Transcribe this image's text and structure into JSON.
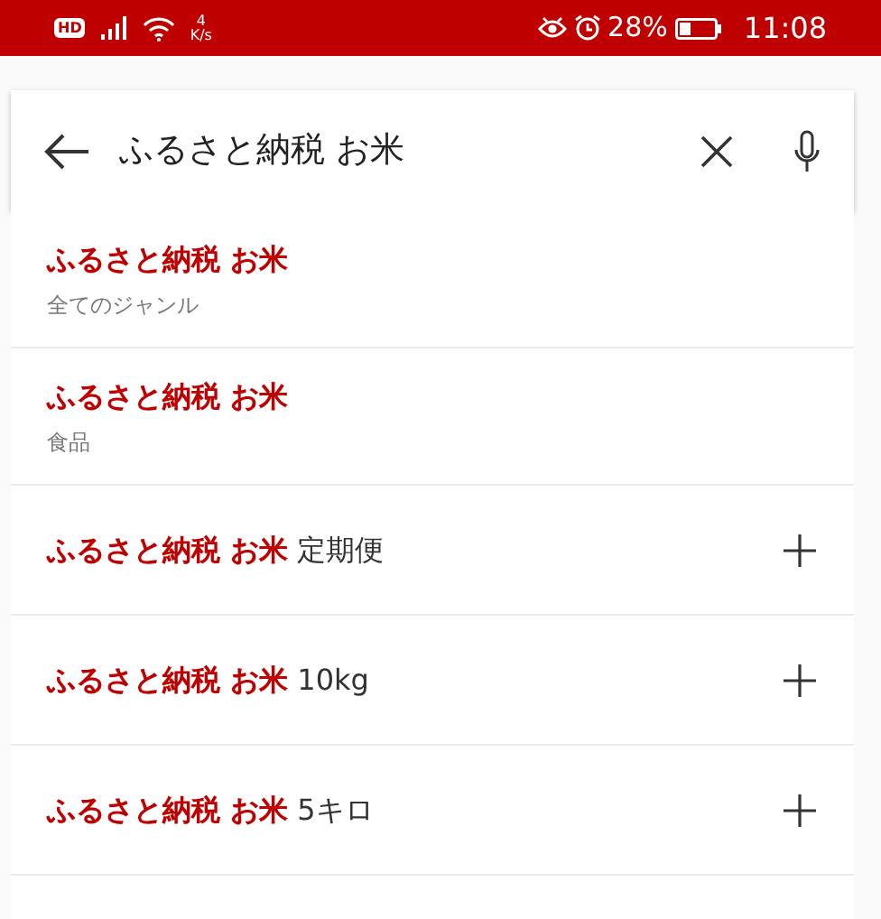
{
  "status_bar": {
    "hd": "HD",
    "speed_value": "4",
    "speed_unit": "K/s",
    "battery": "28%",
    "time": "11:08"
  },
  "search": {
    "value": "ふるさと納税 お米"
  },
  "suggestions": [
    {
      "kind": "category",
      "match": "ふるさと納税 お米",
      "category": "全てのジャンル"
    },
    {
      "kind": "category",
      "match": "ふるさと納税 お米",
      "category": "食品"
    },
    {
      "kind": "append",
      "match": "ふるさと納税 お米",
      "rest": "定期便"
    },
    {
      "kind": "append",
      "match": "ふるさと納税 お米",
      "rest": "10kg"
    },
    {
      "kind": "append",
      "match": "ふるさと納税 お米",
      "rest": "5キロ"
    }
  ]
}
